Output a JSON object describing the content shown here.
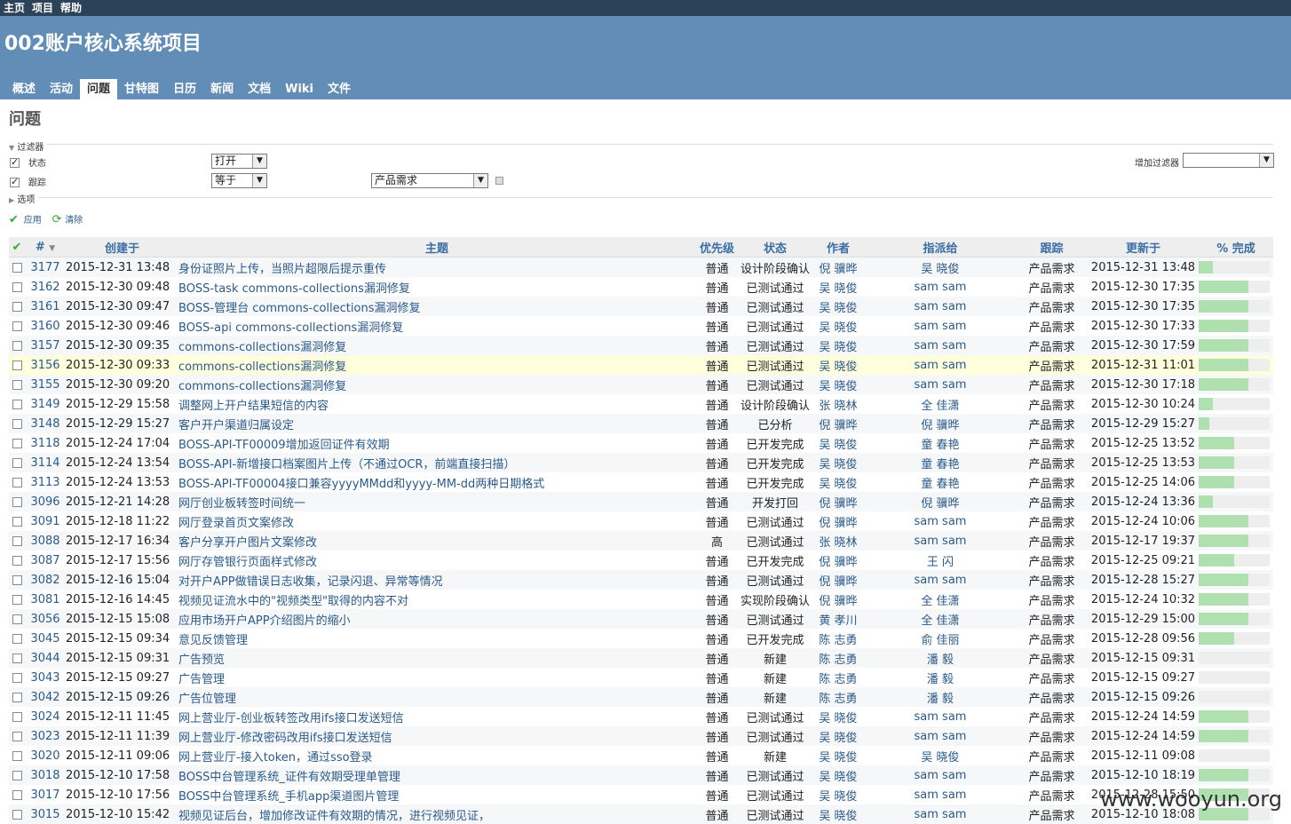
{
  "topnav": [
    "主页",
    "项目",
    "帮助"
  ],
  "project_title": "002账户核心系统项目",
  "tabs": [
    {
      "label": "概述",
      "active": false
    },
    {
      "label": "活动",
      "active": false
    },
    {
      "label": "问题",
      "active": true
    },
    {
      "label": "甘特图",
      "active": false
    },
    {
      "label": "日历",
      "active": false
    },
    {
      "label": "新闻",
      "active": false
    },
    {
      "label": "文档",
      "active": false
    },
    {
      "label": "Wiki",
      "active": false
    },
    {
      "label": "文件",
      "active": false
    }
  ],
  "page_title": "问题",
  "filters": {
    "legend": "过滤器",
    "rows": [
      {
        "label": "状态",
        "checked": true,
        "operator": "打开",
        "value": ""
      },
      {
        "label": "跟踪",
        "checked": true,
        "operator": "等于",
        "value": "产品需求"
      }
    ],
    "add_filter_label": "增加过滤器",
    "add_filter_value": ""
  },
  "options_legend": "选项",
  "actions": {
    "apply": "应用",
    "clear": "清除"
  },
  "columns": [
    "#",
    "创建于",
    "主题",
    "优先级",
    "状态",
    "作者",
    "指派给",
    "跟踪",
    "更新于",
    "% 完成"
  ],
  "issues": [
    {
      "id": "3177",
      "created": "2015-12-31 13:48",
      "subject": "身份证照片上传，当照片超限后提示重传",
      "priority": "普通",
      "status": "设计阶段确认",
      "author": "倪 骥晔",
      "assignee": "吴 晓俊",
      "tracker": "产品需求",
      "updated": "2015-12-31 13:48",
      "done": 20
    },
    {
      "id": "3162",
      "created": "2015-12-30 09:48",
      "subject": "BOSS-task commons-collections漏洞修复",
      "priority": "普通",
      "status": "已测试通过",
      "author": "吴 晓俊",
      "assignee": "sam sam",
      "tracker": "产品需求",
      "updated": "2015-12-30 17:35",
      "done": 70
    },
    {
      "id": "3161",
      "created": "2015-12-30 09:47",
      "subject": "BOSS-管理台 commons-collections漏洞修复",
      "priority": "普通",
      "status": "已测试通过",
      "author": "吴 晓俊",
      "assignee": "sam sam",
      "tracker": "产品需求",
      "updated": "2015-12-30 17:35",
      "done": 70
    },
    {
      "id": "3160",
      "created": "2015-12-30 09:46",
      "subject": "BOSS-api commons-collections漏洞修复",
      "priority": "普通",
      "status": "已测试通过",
      "author": "吴 晓俊",
      "assignee": "sam sam",
      "tracker": "产品需求",
      "updated": "2015-12-30 17:33",
      "done": 70
    },
    {
      "id": "3157",
      "created": "2015-12-30 09:35",
      "subject": "commons-collections漏洞修复",
      "priority": "普通",
      "status": "已测试通过",
      "author": "吴 晓俊",
      "assignee": "sam sam",
      "tracker": "产品需求",
      "updated": "2015-12-30 17:59",
      "done": 70
    },
    {
      "id": "3156",
      "created": "2015-12-30 09:33",
      "subject": "commons-collections漏洞修复",
      "priority": "普通",
      "status": "已测试通过",
      "author": "吴 晓俊",
      "assignee": "sam sam",
      "tracker": "产品需求",
      "updated": "2015-12-31 11:01",
      "done": 70
    },
    {
      "id": "3155",
      "created": "2015-12-30 09:20",
      "subject": "commons-collections漏洞修复",
      "priority": "普通",
      "status": "已测试通过",
      "author": "吴 晓俊",
      "assignee": "sam sam",
      "tracker": "产品需求",
      "updated": "2015-12-30 17:18",
      "done": 70
    },
    {
      "id": "3149",
      "created": "2015-12-29 15:58",
      "subject": "调整网上开户结果短信的内容",
      "priority": "普通",
      "status": "设计阶段确认",
      "author": "张 晓林",
      "assignee": "全 佳潇",
      "tracker": "产品需求",
      "updated": "2015-12-30 10:24",
      "done": 20
    },
    {
      "id": "3148",
      "created": "2015-12-29 15:27",
      "subject": "客户开户渠道归属设定",
      "priority": "普通",
      "status": "已分析",
      "author": "倪 骥晔",
      "assignee": "倪 骥晔",
      "tracker": "产品需求",
      "updated": "2015-12-29 15:27",
      "done": 15
    },
    {
      "id": "3118",
      "created": "2015-12-24 17:04",
      "subject": "BOSS-API-TF00009增加返回证件有效期",
      "priority": "普通",
      "status": "已开发完成",
      "author": "吴 晓俊",
      "assignee": "童 春艳",
      "tracker": "产品需求",
      "updated": "2015-12-25 13:52",
      "done": 50
    },
    {
      "id": "3114",
      "created": "2015-12-24 13:54",
      "subject": "BOSS-API-新增接口档案图片上传（不通过OCR，前端直接扫描）",
      "priority": "普通",
      "status": "已开发完成",
      "author": "吴 晓俊",
      "assignee": "童 春艳",
      "tracker": "产品需求",
      "updated": "2015-12-25 13:53",
      "done": 50
    },
    {
      "id": "3113",
      "created": "2015-12-24 13:53",
      "subject": "BOSS-API-TF00004接口兼容yyyyMMdd和yyyy-MM-dd两种日期格式",
      "priority": "普通",
      "status": "已开发完成",
      "author": "吴 晓俊",
      "assignee": "童 春艳",
      "tracker": "产品需求",
      "updated": "2015-12-25 14:06",
      "done": 50
    },
    {
      "id": "3096",
      "created": "2015-12-21 14:28",
      "subject": "网厅创业板转签时间统一",
      "priority": "普通",
      "status": "开发打回",
      "author": "倪 骥晔",
      "assignee": "倪 骥晔",
      "tracker": "产品需求",
      "updated": "2015-12-24 13:36",
      "done": 20
    },
    {
      "id": "3091",
      "created": "2015-12-18 11:22",
      "subject": "网厅登录首页文案修改",
      "priority": "普通",
      "status": "已测试通过",
      "author": "倪 骥晔",
      "assignee": "sam sam",
      "tracker": "产品需求",
      "updated": "2015-12-24 10:06",
      "done": 70
    },
    {
      "id": "3088",
      "created": "2015-12-17 16:34",
      "subject": "客户分享开户图片文案修改",
      "priority": "高",
      "status": "已测试通过",
      "author": "张 晓林",
      "assignee": "sam sam",
      "tracker": "产品需求",
      "updated": "2015-12-17 19:37",
      "done": 70
    },
    {
      "id": "3087",
      "created": "2015-12-17 15:56",
      "subject": "网厅存管银行页面样式修改",
      "priority": "普通",
      "status": "已开发完成",
      "author": "倪 骥晔",
      "assignee": "王 闪",
      "tracker": "产品需求",
      "updated": "2015-12-25 09:21",
      "done": 50
    },
    {
      "id": "3082",
      "created": "2015-12-16 15:04",
      "subject": "对开户APP做错误日志收集，记录闪退、异常等情况",
      "priority": "普通",
      "status": "已测试通过",
      "author": "倪 骥晔",
      "assignee": "sam sam",
      "tracker": "产品需求",
      "updated": "2015-12-28 15:27",
      "done": 70
    },
    {
      "id": "3081",
      "created": "2015-12-16 14:45",
      "subject": "视频见证流水中的\"视频类型\"取得的内容不对",
      "priority": "普通",
      "status": "实现阶段确认",
      "author": "倪 骥晔",
      "assignee": "全 佳潇",
      "tracker": "产品需求",
      "updated": "2015-12-24 10:32",
      "done": 70
    },
    {
      "id": "3056",
      "created": "2015-12-15 15:08",
      "subject": "应用市场开户APP介绍图片的缩小",
      "priority": "普通",
      "status": "已测试通过",
      "author": "黄 孝川",
      "assignee": "全 佳潇",
      "tracker": "产品需求",
      "updated": "2015-12-29 15:00",
      "done": 70
    },
    {
      "id": "3045",
      "created": "2015-12-15 09:34",
      "subject": "意见反馈管理",
      "priority": "普通",
      "status": "已开发完成",
      "author": "陈 志勇",
      "assignee": "俞 佳丽",
      "tracker": "产品需求",
      "updated": "2015-12-28 09:56",
      "done": 50
    },
    {
      "id": "3044",
      "created": "2015-12-15 09:31",
      "subject": "广告预览",
      "priority": "普通",
      "status": "新建",
      "author": "陈 志勇",
      "assignee": "潘 毅",
      "tracker": "产品需求",
      "updated": "2015-12-15 09:31",
      "done": 0
    },
    {
      "id": "3043",
      "created": "2015-12-15 09:27",
      "subject": "广告管理",
      "priority": "普通",
      "status": "新建",
      "author": "陈 志勇",
      "assignee": "潘 毅",
      "tracker": "产品需求",
      "updated": "2015-12-15 09:27",
      "done": 0
    },
    {
      "id": "3042",
      "created": "2015-12-15 09:26",
      "subject": "广告位管理",
      "priority": "普通",
      "status": "新建",
      "author": "陈 志勇",
      "assignee": "潘 毅",
      "tracker": "产品需求",
      "updated": "2015-12-15 09:26",
      "done": 0
    },
    {
      "id": "3024",
      "created": "2015-12-11 11:45",
      "subject": "网上营业厅-创业板转签改用ifs接口发送短信",
      "priority": "普通",
      "status": "已测试通过",
      "author": "吴 晓俊",
      "assignee": "sam sam",
      "tracker": "产品需求",
      "updated": "2015-12-24 14:59",
      "done": 70
    },
    {
      "id": "3023",
      "created": "2015-12-11 11:39",
      "subject": "网上营业厅-修改密码改用ifs接口发送短信",
      "priority": "普通",
      "status": "已测试通过",
      "author": "吴 晓俊",
      "assignee": "sam sam",
      "tracker": "产品需求",
      "updated": "2015-12-24 14:59",
      "done": 70
    },
    {
      "id": "3020",
      "created": "2015-12-11 09:06",
      "subject": "网上营业厅-接入token，通过sso登录",
      "priority": "普通",
      "status": "新建",
      "author": "吴 晓俊",
      "assignee": "吴 晓俊",
      "tracker": "产品需求",
      "updated": "2015-12-11 09:08",
      "done": 0
    },
    {
      "id": "3018",
      "created": "2015-12-10 17:58",
      "subject": "BOSS中台管理系统_证件有效期受理单管理",
      "priority": "普通",
      "status": "已测试通过",
      "author": "吴 晓俊",
      "assignee": "sam sam",
      "tracker": "产品需求",
      "updated": "2015-12-10 18:19",
      "done": 70
    },
    {
      "id": "3017",
      "created": "2015-12-10 17:56",
      "subject": "BOSS中台管理系统_手机app渠道图片管理",
      "priority": "普通",
      "status": "已测试通过",
      "author": "吴 晓俊",
      "assignee": "sam sam",
      "tracker": "产品需求",
      "updated": "2015-12-28 15:50",
      "done": 70
    },
    {
      "id": "3015",
      "created": "2015-12-10 15:42",
      "subject": "视频见证后台，增加修改证件有效期的情况，进行视频见证，",
      "priority": "普通",
      "status": "已测试通过",
      "author": "吴 晓俊",
      "assignee": "sam sam",
      "tracker": "产品需求",
      "updated": "2015-12-10 18:08",
      "done": 70
    }
  ],
  "watermark": "www.wooyun.org",
  "colors": {
    "header": "#628db6",
    "topbar": "#2c4258",
    "link": "#2a5a8a",
    "progress": "#b0e0b0",
    "highlight": "#ffffdd"
  }
}
